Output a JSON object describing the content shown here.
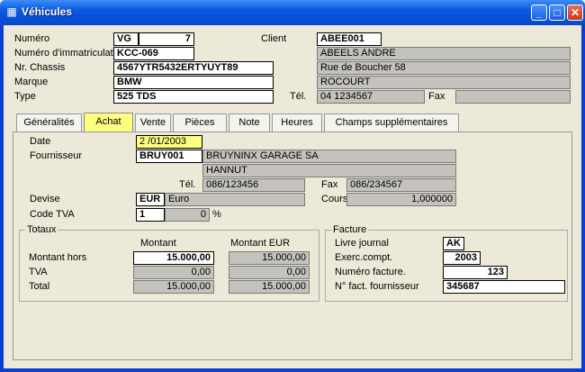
{
  "window": {
    "title": "Véhicules",
    "minimize": "_",
    "maximize": "□",
    "close": "✕",
    "icon": "app-icon"
  },
  "vehicle": {
    "numero_label": "Numéro",
    "numero_prefix": "VG",
    "numero_value": "7",
    "immat_label": "Numéro d'immatriculat",
    "immat_value": "KCC-069",
    "chassis_label": "Nr. Chassis",
    "chassis_value": "4567YTR5432ERTYUYT89",
    "marque_label": "Marque",
    "marque_value": "BMW",
    "type_label": "Type",
    "type_value": "525 TDS"
  },
  "client": {
    "label": "Client",
    "code": "ABEE001",
    "name": "ABEELS ANDRE",
    "street": "Rue de Boucher 58",
    "city": "ROCOURT",
    "tel_label": "Tél.",
    "tel_value": "04 1234567",
    "fax_label": "Fax",
    "fax_value": ""
  },
  "tabs": [
    {
      "label": "Généralités"
    },
    {
      "label": "Achat"
    },
    {
      "label": "Vente"
    },
    {
      "label": "Pièces"
    },
    {
      "label": "Note"
    },
    {
      "label": "Heures"
    },
    {
      "label": "Champs supplémentaires"
    }
  ],
  "achat": {
    "date_label": "Date",
    "date_value": "2 /01/2003",
    "fournisseur_label": "Fournisseur",
    "fournisseur_code": "BRUY001",
    "fournisseur_name": "BRUYNINX GARAGE SA",
    "fournisseur_city": "HANNUT",
    "tel_label": "Tél.",
    "tel_value": "086/123456",
    "fax_label": "Fax",
    "fax_value": "086/234567",
    "devise_label": "Devise",
    "devise_code": "EUR",
    "devise_name": "Euro",
    "cours_label": "Cours",
    "cours_value": "1,000000",
    "codetva_label": "Code TVA",
    "codetva_value": "1",
    "codetva_pct": "0",
    "pct_sign": "%"
  },
  "totaux": {
    "title": "Totaux",
    "col_montant": "Montant",
    "col_montant_eur": "Montant EUR",
    "rows": [
      {
        "label": "Montant hors",
        "montant": "15.000,00",
        "eur": "15.000,00"
      },
      {
        "label": "TVA",
        "montant": "0,00",
        "eur": "0,00"
      },
      {
        "label": "Total",
        "montant": "15.000,00",
        "eur": "15.000,00"
      }
    ]
  },
  "facture": {
    "title": "Facture",
    "journal_label": "Livre journal",
    "journal_value": "AK",
    "exerc_label": "Exerc.compt.",
    "exerc_value": "2003",
    "numero_label": "Numéro facture.",
    "numero_value": "123",
    "fourn_label": "N° fact. fournisseur",
    "fourn_value": "345687"
  }
}
